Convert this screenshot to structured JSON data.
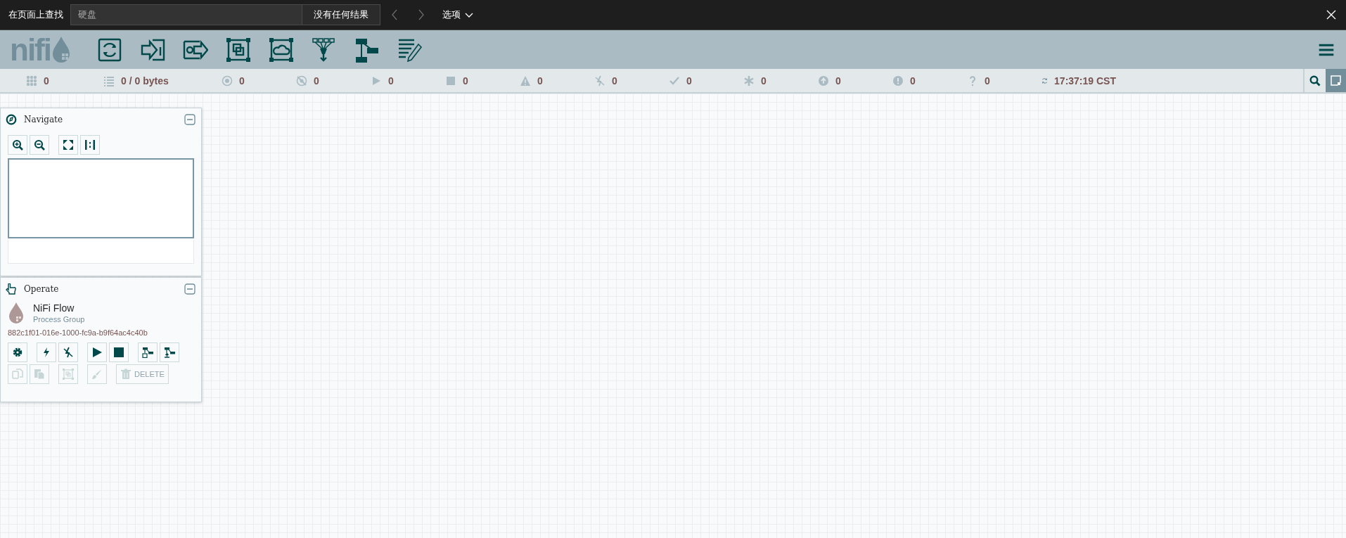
{
  "find_bar": {
    "label": "在页面上查找",
    "query": "硬盘",
    "result": "没有任何结果",
    "options": "选项"
  },
  "toolbar": {
    "logo": "nifi"
  },
  "status_bar": {
    "items": [
      {
        "kind": "threads",
        "value": "0"
      },
      {
        "kind": "queue",
        "value": "0 / 0 bytes"
      },
      {
        "kind": "transmitting",
        "value": "0"
      },
      {
        "kind": "not-transmitting",
        "value": "0"
      },
      {
        "kind": "running",
        "value": "0"
      },
      {
        "kind": "stopped",
        "value": "0"
      },
      {
        "kind": "invalid",
        "value": "0"
      },
      {
        "kind": "disabled",
        "value": "0"
      },
      {
        "kind": "up-to-date",
        "value": "0"
      },
      {
        "kind": "modified",
        "value": "0"
      },
      {
        "kind": "stale",
        "value": "0"
      },
      {
        "kind": "error",
        "value": "0"
      },
      {
        "kind": "unknown",
        "value": "0"
      }
    ],
    "refreshed": "17:37:19 CST"
  },
  "navigate": {
    "title": "Navigate"
  },
  "operate": {
    "title": "Operate",
    "name": "NiFi Flow",
    "type": "Process Group",
    "id": "882c1f01-016e-1000-fc9a-b9f64ac4c40b",
    "button_rows": [
      [
        {
          "kind": "gear",
          "disabled": false
        },
        {
          "kind": "bolt",
          "disabled": false
        },
        {
          "kind": "unbolt",
          "disabled": false
        },
        {
          "kind": "play",
          "disabled": false
        },
        {
          "kind": "stop",
          "disabled": false
        },
        {
          "kind": "save-template",
          "disabled": false
        },
        {
          "kind": "upload-template",
          "disabled": false
        }
      ],
      [
        {
          "kind": "copy",
          "disabled": true
        },
        {
          "kind": "paste",
          "disabled": true
        },
        {
          "kind": "group",
          "disabled": true
        },
        {
          "kind": "brush",
          "disabled": true
        },
        {
          "kind": "delete",
          "disabled": true,
          "label": "DELETE"
        }
      ]
    ]
  }
}
